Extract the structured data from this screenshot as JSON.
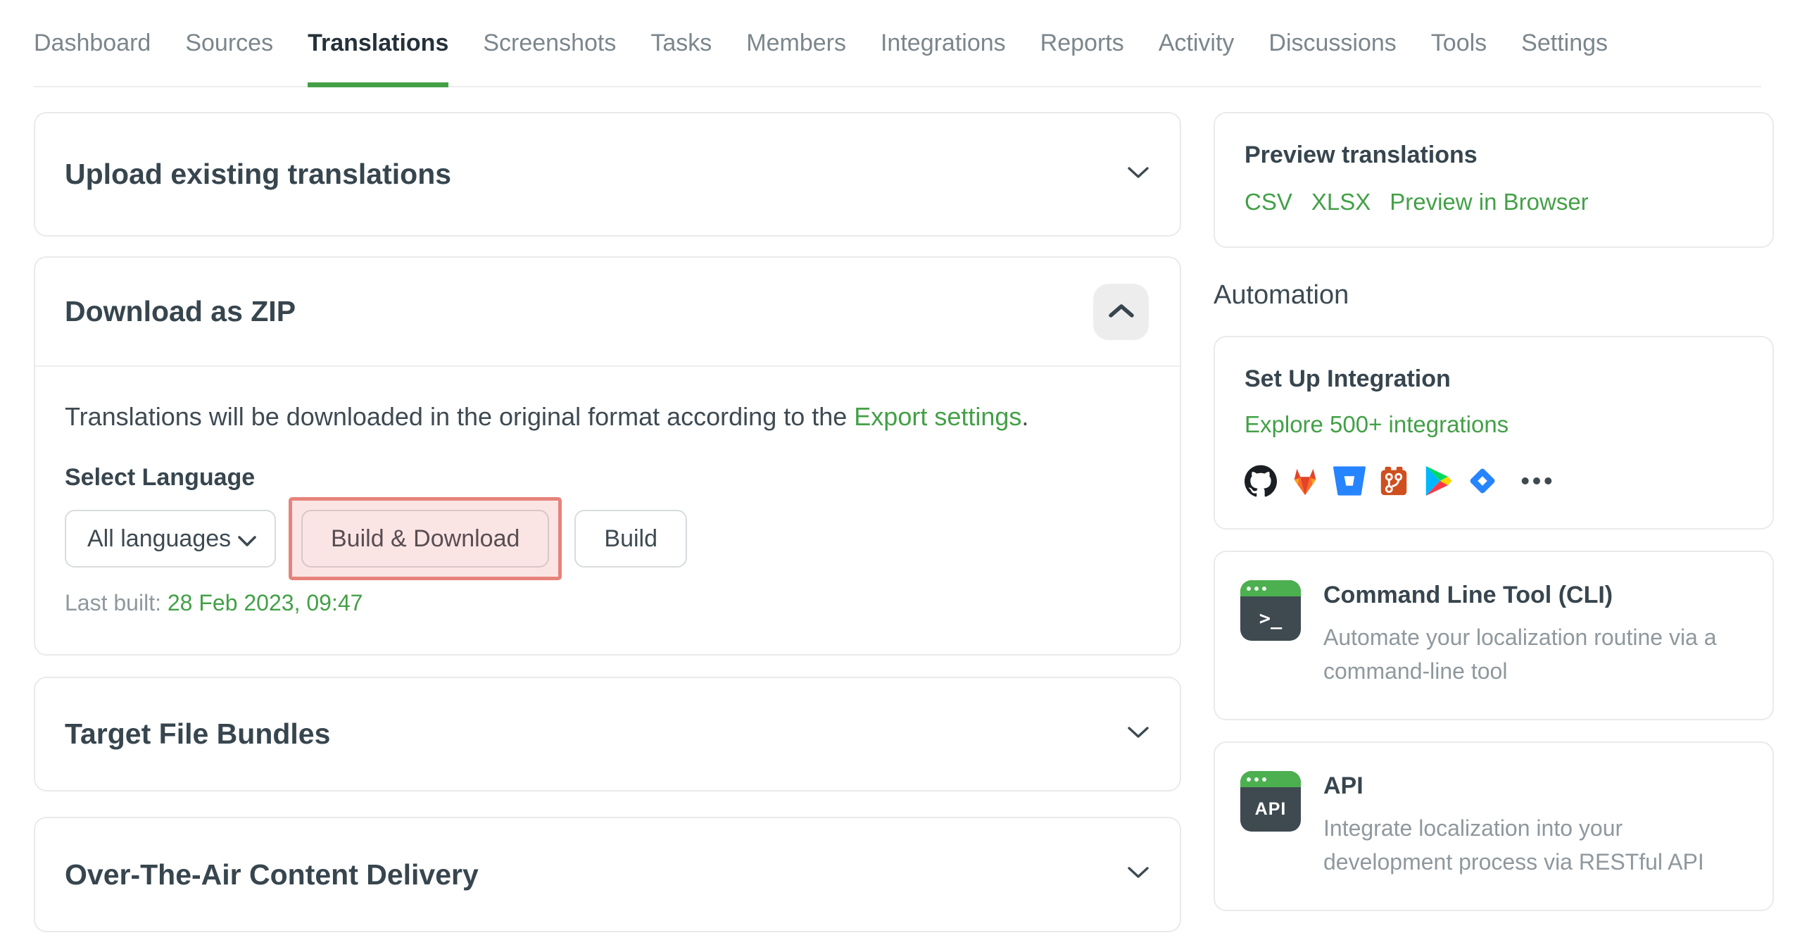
{
  "nav": {
    "items": [
      {
        "label": "Dashboard",
        "active": false
      },
      {
        "label": "Sources",
        "active": false
      },
      {
        "label": "Translations",
        "active": true
      },
      {
        "label": "Screenshots",
        "active": false
      },
      {
        "label": "Tasks",
        "active": false
      },
      {
        "label": "Members",
        "active": false
      },
      {
        "label": "Integrations",
        "active": false
      },
      {
        "label": "Reports",
        "active": false
      },
      {
        "label": "Activity",
        "active": false
      },
      {
        "label": "Discussions",
        "active": false
      },
      {
        "label": "Tools",
        "active": false
      },
      {
        "label": "Settings",
        "active": false
      }
    ]
  },
  "main": {
    "upload_panel": {
      "title": "Upload existing translations"
    },
    "download_panel": {
      "title": "Download as ZIP",
      "description_prefix": "Translations will be downloaded in the original format according to the ",
      "description_link": "Export settings",
      "description_suffix": ".",
      "select_label": "Select Language",
      "language_value": "All languages",
      "build_download_label": "Build & Download",
      "build_label": "Build",
      "last_built_label": "Last built: ",
      "last_built_value": "28 Feb 2023, 09:47"
    },
    "bundles_panel": {
      "title": "Target File Bundles"
    },
    "ota_panel": {
      "title": "Over-The-Air Content Delivery"
    }
  },
  "sidebar": {
    "preview": {
      "title": "Preview translations",
      "links": [
        "CSV",
        "XLSX",
        "Preview in Browser"
      ]
    },
    "automation_heading": "Automation",
    "integration": {
      "title": "Set Up Integration",
      "link": "Explore 500+ integrations",
      "icons": [
        "github",
        "gitlab",
        "bitbucket",
        "git",
        "google-play",
        "jira",
        "more"
      ]
    },
    "cli": {
      "icon_text": ">_",
      "title": "Command Line Tool (CLI)",
      "description": "Automate your localization routine via a command-line tool"
    },
    "api": {
      "icon_text": "API",
      "title": "API",
      "description": "Integrate localization into your development process via RESTful API"
    }
  },
  "colors": {
    "accent_green": "#43a047",
    "highlight_red": "#e6837b",
    "heading_dark": "#37454e"
  }
}
